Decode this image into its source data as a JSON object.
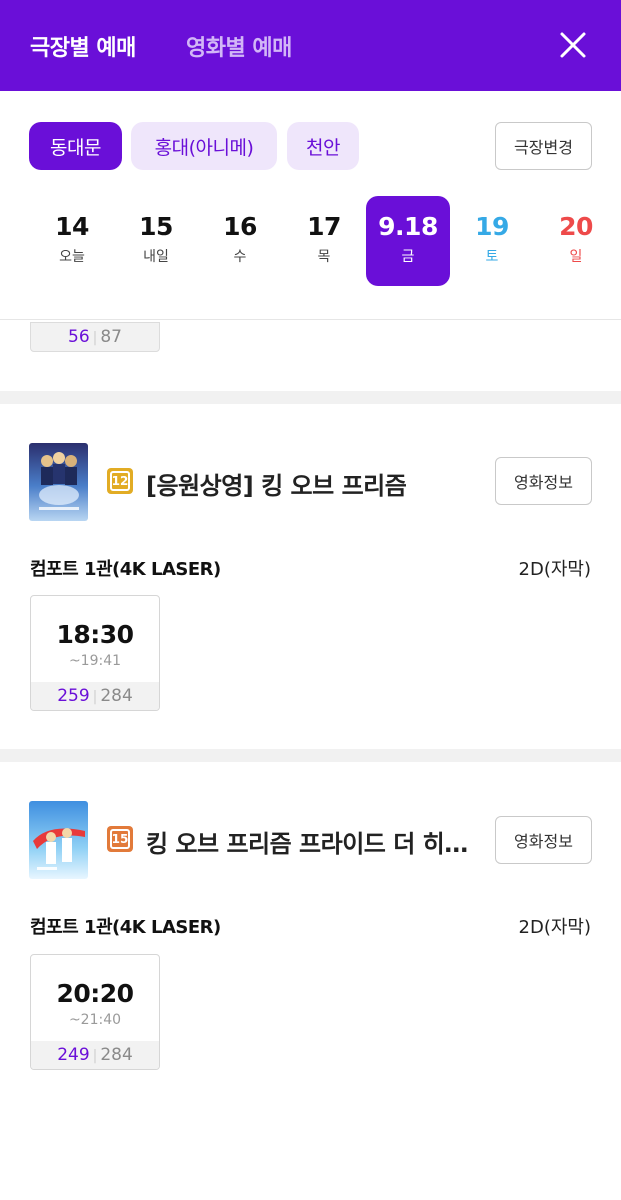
{
  "header": {
    "tab_theater": "극장별 예매",
    "tab_movie": "영화별 예매"
  },
  "theaters": {
    "chips": [
      "동대문",
      "홍대(아니메)",
      "천안"
    ],
    "change_label": "극장변경"
  },
  "dates": [
    {
      "num": "14",
      "dow": "오늘"
    },
    {
      "num": "15",
      "dow": "내일"
    },
    {
      "num": "16",
      "dow": "수"
    },
    {
      "num": "17",
      "dow": "목"
    },
    {
      "num": "9.18",
      "dow": "금"
    },
    {
      "num": "19",
      "dow": "토"
    },
    {
      "num": "20",
      "dow": "일"
    }
  ],
  "partial_card": {
    "available": "56",
    "total": "87"
  },
  "movies": [
    {
      "rating": "12",
      "rating_color": "#e2ac24",
      "title": "[응원상영] 킹 오브 프리즘",
      "info_label": "영화정보",
      "screen": "컴포트 1관(4K LASER)",
      "format": "2D(자막)",
      "showtime": {
        "start": "18:30",
        "end": "~19:41",
        "available": "259",
        "total": "284"
      }
    },
    {
      "rating": "15",
      "rating_color": "#e27a3a",
      "title": "킹 오브 프리즘 프라이드 더 히어로",
      "info_label": "영화정보",
      "screen": "컴포트 1관(4K LASER)",
      "format": "2D(자막)",
      "showtime": {
        "start": "20:20",
        "end": "~21:40",
        "available": "249",
        "total": "284"
      }
    }
  ],
  "colors": {
    "accent": "#6a0fd8",
    "saturday": "#35a9e6",
    "sunday": "#ee4a4a"
  }
}
